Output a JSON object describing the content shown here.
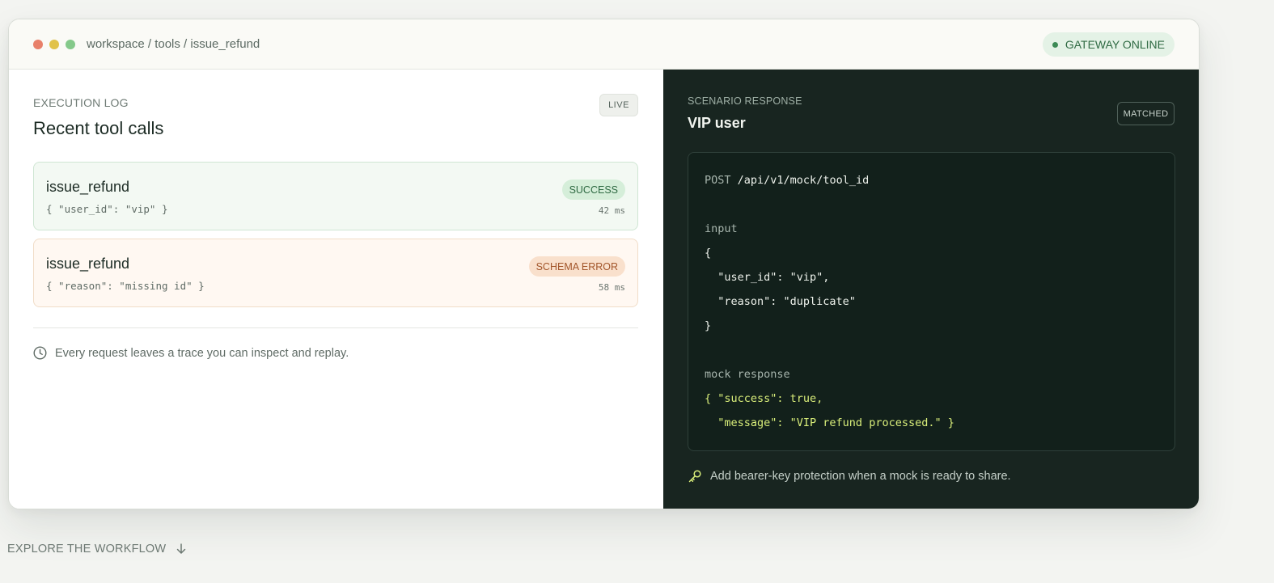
{
  "window": {
    "breadcrumb": "workspace / tools / issue_refund",
    "status": "GATEWAY ONLINE"
  },
  "log": {
    "eyebrow": "EXECUTION LOG",
    "title": "Recent tool calls",
    "live_badge": "LIVE",
    "calls": [
      {
        "name": "issue_refund",
        "args": "{ \"user_id\": \"vip\" }",
        "status": "SUCCESS",
        "duration": "42 ms"
      },
      {
        "name": "issue_refund",
        "args": "{ \"reason\": \"missing id\" }",
        "status": "SCHEMA ERROR",
        "duration": "58 ms"
      }
    ],
    "note": "Every request leaves a trace you can inspect and replay."
  },
  "scenario": {
    "eyebrow": "SCENARIO RESPONSE",
    "title": "VIP user",
    "matched_badge": "MATCHED",
    "request_method": "POST",
    "request_path": "/api/v1/mock/tool_id",
    "input_label": "input",
    "input_lines": [
      "{",
      "  \"user_id\": \"vip\",",
      "  \"reason\": \"duplicate\"",
      "}"
    ],
    "response_label": "mock response",
    "response_lines": [
      "{ \"success\": true,",
      "  \"message\": \"VIP refund processed.\" }"
    ],
    "note": "Add bearer-key protection when a mock is ready to share."
  },
  "footer": {
    "explore": "EXPLORE THE WORKFLOW"
  },
  "colors": {
    "page_bg": "#f3f4f1",
    "dark_panel": "#182520",
    "success": "#2f6a43",
    "error": "#a2552a",
    "code_highlight": "#d9ee7a"
  },
  "icons": [
    "clock-icon",
    "key-icon",
    "arrow-down-icon",
    "status-dot-icon"
  ]
}
